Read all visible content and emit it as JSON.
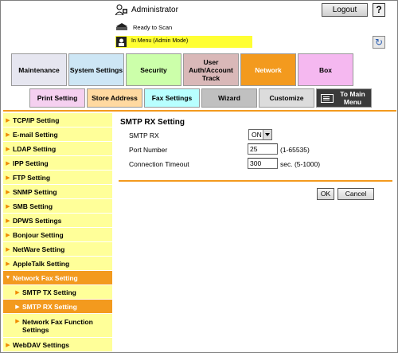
{
  "header": {
    "user": "Administrator",
    "logout_label": "Logout",
    "help_label": "?",
    "status": "Ready to Scan",
    "mode": "In Menu (Admin Mode)"
  },
  "main_tabs": [
    {
      "label": "Maintenance",
      "color": "#e6e6f0"
    },
    {
      "label": "System Settings",
      "color": "#cde6f5"
    },
    {
      "label": "Security",
      "color": "#ccffaa"
    },
    {
      "label": "User Auth/Account Track",
      "color": "#d9b8b8"
    },
    {
      "label": "Network",
      "color": "#f39a1e",
      "selected": true
    },
    {
      "label": "Box",
      "color": "#f5b8f0"
    }
  ],
  "sub_tabs": [
    {
      "label": "Print Setting",
      "color": "#f5d0f0"
    },
    {
      "label": "Store Address",
      "color": "#ffd9a0"
    },
    {
      "label": "Fax Settings",
      "color": "#b8ffff"
    },
    {
      "label": "Wizard",
      "color": "#c0c0c0"
    },
    {
      "label": "Customize",
      "color": "#dcdcdc"
    },
    {
      "label": "To Main Menu",
      "color": "#3a3a3a"
    }
  ],
  "nav": {
    "items": [
      {
        "label": "TCP/IP Setting"
      },
      {
        "label": "E-mail Setting"
      },
      {
        "label": "LDAP Setting"
      },
      {
        "label": "IPP Setting"
      },
      {
        "label": "FTP Setting"
      },
      {
        "label": "SNMP Setting"
      },
      {
        "label": "SMB Setting"
      },
      {
        "label": "DPWS Settings"
      },
      {
        "label": "Bonjour Setting"
      },
      {
        "label": "NetWare Setting"
      },
      {
        "label": "AppleTalk Setting"
      },
      {
        "label": "Network Fax Setting"
      },
      {
        "label": "SMTP TX Setting"
      },
      {
        "label": "SMTP RX Setting"
      },
      {
        "label": "Network Fax Function Settings"
      },
      {
        "label": "WebDAV Settings"
      }
    ]
  },
  "content": {
    "title": "SMTP RX Setting",
    "smtp_rx_label": "SMTP RX",
    "smtp_rx_value": "ON",
    "port_label": "Port Number",
    "port_value": "25",
    "port_hint": "(1-65535)",
    "timeout_label": "Connection Timeout",
    "timeout_value": "300",
    "timeout_hint": "sec. (5-1000)",
    "ok_label": "OK",
    "cancel_label": "Cancel"
  },
  "colors": {
    "accent": "#f39a1e",
    "nav_bg": "#ffff99",
    "mode_bar": "#ffff33"
  }
}
